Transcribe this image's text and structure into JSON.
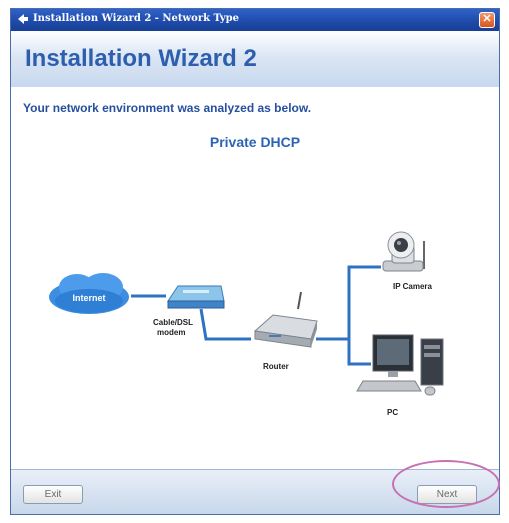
{
  "window": {
    "title": "Installation Wizard 2 - Network Type",
    "close_label": "✕"
  },
  "header": {
    "title": "Installation Wizard 2"
  },
  "content": {
    "description": "Your network environment was analyzed as below.",
    "network_type": "Private DHCP"
  },
  "diagram": {
    "internet_label": "Internet",
    "modem_label_line1": "Cable/DSL",
    "modem_label_line2": "modem",
    "router_label": "Router",
    "camera_label": "IP Camera",
    "pc_label": "PC",
    "link_color": "#2f72c4"
  },
  "footer": {
    "exit_label": "Exit",
    "next_label": "Next"
  },
  "colors": {
    "title_bar": "#1e4aa8",
    "heading": "#2d5fae",
    "highlight_ring": "#c770b2"
  }
}
